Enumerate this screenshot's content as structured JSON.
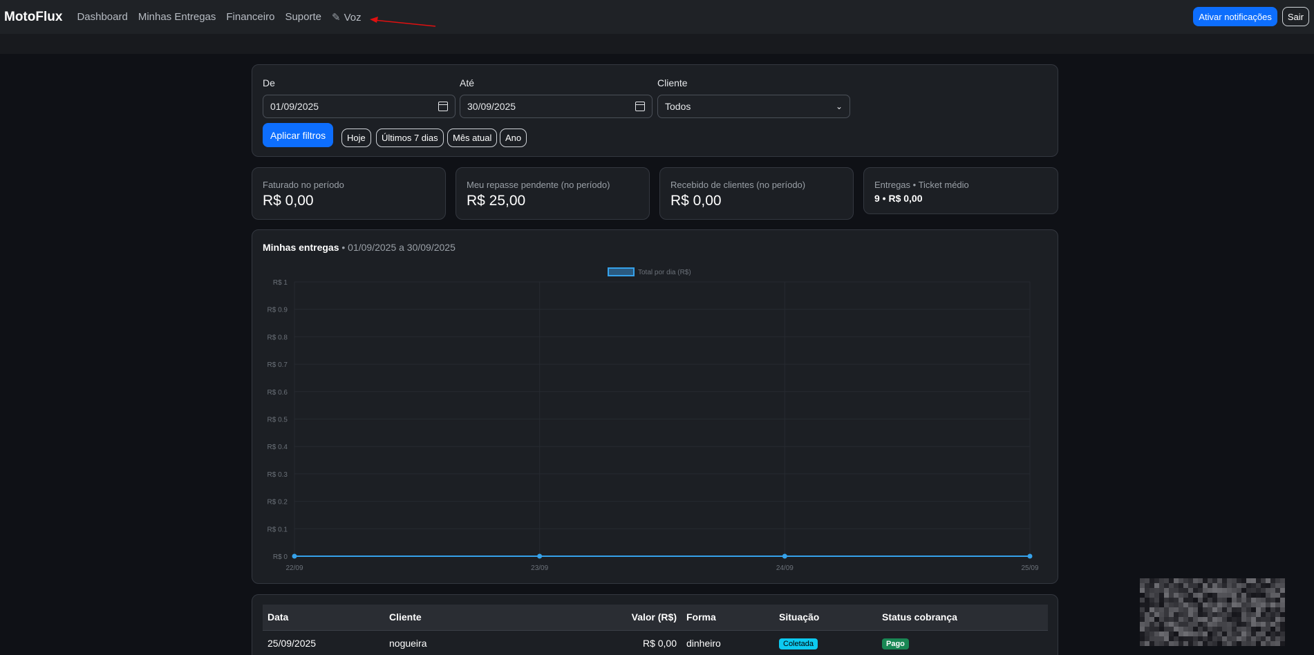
{
  "navbar": {
    "brand": "MotoFlux",
    "links": [
      "Dashboard",
      "Minhas Entregas",
      "Financeiro",
      "Suporte",
      "Voz"
    ],
    "notify_button": "Ativar notificações",
    "logout_button": "Sair"
  },
  "filters": {
    "from_label": "De",
    "from_value": "01/09/2025",
    "to_label": "Até",
    "to_value": "30/09/2025",
    "client_label": "Cliente",
    "client_value": "Todos",
    "apply_button": "Aplicar filtros",
    "quick": [
      "Hoje",
      "Últimos 7 dias",
      "Mês atual",
      "Ano"
    ]
  },
  "stats": [
    {
      "label": "Faturado no período",
      "value": "R$ 0,00"
    },
    {
      "label": "Meu repasse pendente (no período)",
      "value": "R$ 25,00"
    },
    {
      "label": "Recebido de clientes (no período)",
      "value": "R$ 0,00"
    },
    {
      "label": "Entregas • Ticket médio",
      "value": "9 • R$ 0,00"
    }
  ],
  "chart_card": {
    "title": "Minhas entregas",
    "range": " • 01/09/2025 a 30/09/2025"
  },
  "chart_data": {
    "type": "line",
    "categories": [
      "22/09",
      "23/09",
      "24/09",
      "25/09"
    ],
    "series": [
      {
        "name": "Total por dia (R$)",
        "values": [
          0,
          0,
          0,
          0
        ]
      }
    ],
    "ylim": [
      0,
      1
    ],
    "yticks": [
      "R$ 0",
      "R$ 0.1",
      "R$ 0.2",
      "R$ 0.3",
      "R$ 0.4",
      "R$ 0.5",
      "R$ 0.6",
      "R$ 0.7",
      "R$ 0.8",
      "R$ 0.9",
      "R$ 1"
    ],
    "legend": "top",
    "grid": true,
    "color": "#36a2eb"
  },
  "table": {
    "headers": [
      "Data",
      "Cliente",
      "Valor (R$)",
      "Forma",
      "Situação",
      "Status cobrança"
    ],
    "rows": [
      {
        "data": "25/09/2025",
        "cliente": "nogueira",
        "valor": "R$ 0,00",
        "forma": "dinheiro",
        "situacao": "Coletada",
        "status": "Pago"
      }
    ]
  },
  "colors": {
    "accent": "#0d6efd",
    "navbar": "#1f2226",
    "background": "#0f1116",
    "card": "#1c1f24"
  }
}
